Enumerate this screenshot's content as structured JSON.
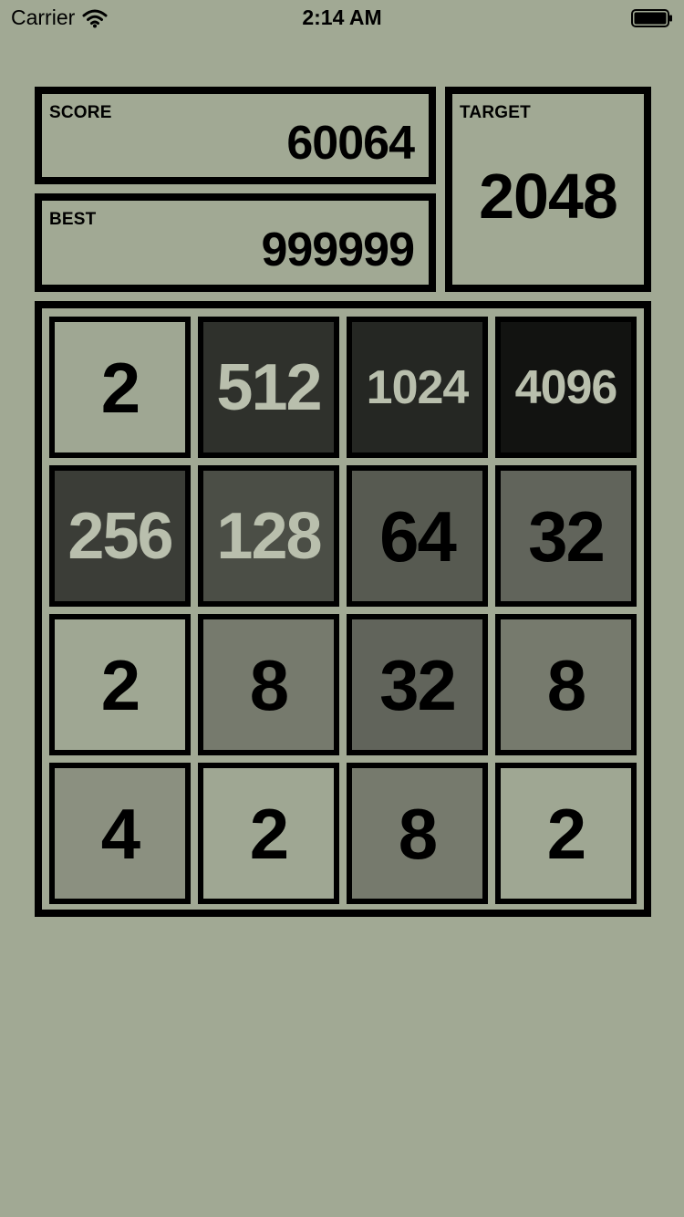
{
  "status_bar": {
    "carrier": "Carrier",
    "time": "2:14 AM",
    "icons": [
      "wifi-icon",
      "battery-icon"
    ]
  },
  "score": {
    "label": "SCORE",
    "value": "60064"
  },
  "best": {
    "label": "BEST",
    "value": "999999"
  },
  "target": {
    "label": "TARGET",
    "value": "2048"
  },
  "colors": {
    "background": "#a1a994",
    "border": "#000000",
    "tile_light_text": "#b9bfad",
    "tile_dark_text": "#000000"
  },
  "board": {
    "rows": [
      [
        {
          "value": "2",
          "bg": "#9fa793",
          "fg": "#000000"
        },
        {
          "value": "512",
          "bg": "#2f312c",
          "fg": "#b9bfad"
        },
        {
          "value": "1024",
          "bg": "#252723",
          "fg": "#b9bfad"
        },
        {
          "value": "4096",
          "bg": "#121311",
          "fg": "#b9bfad"
        }
      ],
      [
        {
          "value": "256",
          "bg": "#3b3d37",
          "fg": "#b9bfad"
        },
        {
          "value": "128",
          "bg": "#4b4e46",
          "fg": "#b9bfad"
        },
        {
          "value": "64",
          "bg": "#575a51",
          "fg": "#000000"
        },
        {
          "value": "32",
          "bg": "#61645b",
          "fg": "#000000"
        }
      ],
      [
        {
          "value": "2",
          "bg": "#9fa793",
          "fg": "#000000"
        },
        {
          "value": "8",
          "bg": "#767a6d",
          "fg": "#000000"
        },
        {
          "value": "32",
          "bg": "#61645b",
          "fg": "#000000"
        },
        {
          "value": "8",
          "bg": "#767a6d",
          "fg": "#000000"
        }
      ],
      [
        {
          "value": "4",
          "bg": "#8b9080",
          "fg": "#000000"
        },
        {
          "value": "2",
          "bg": "#9fa793",
          "fg": "#000000"
        },
        {
          "value": "8",
          "bg": "#767a6d",
          "fg": "#000000"
        },
        {
          "value": "2",
          "bg": "#9fa793",
          "fg": "#000000"
        }
      ]
    ]
  }
}
